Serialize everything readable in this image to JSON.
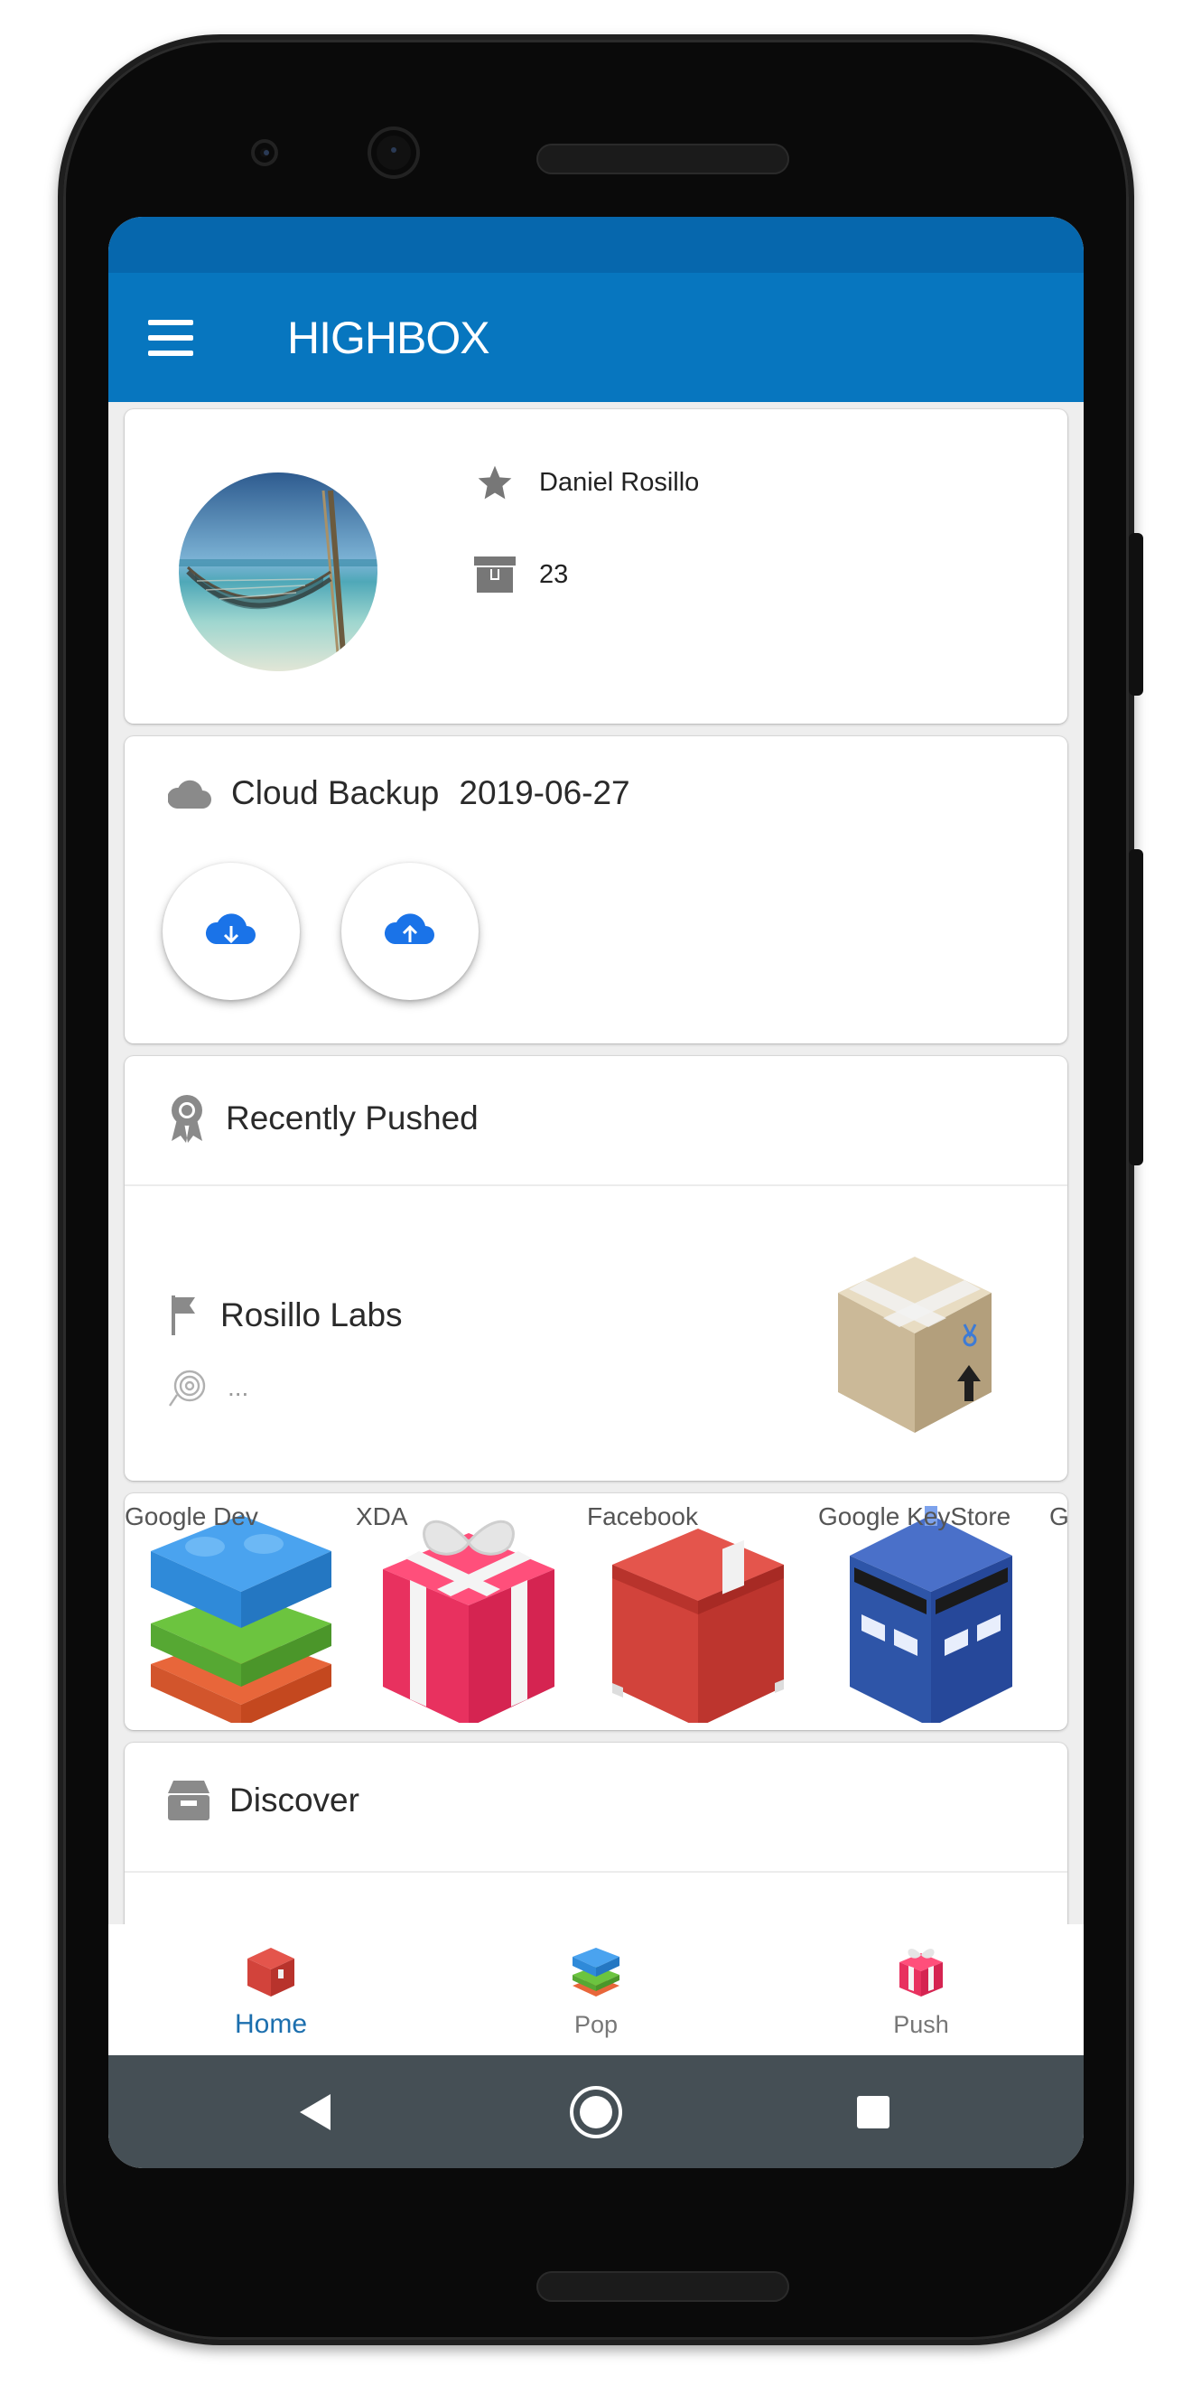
{
  "app": {
    "title": "HIGHBOX",
    "accent_color": "#0776bf",
    "status_bar_color": "#0667ad"
  },
  "profile": {
    "name": "Daniel Rosillo",
    "box_count": "23",
    "name_icon": "star-icon",
    "count_icon": "archive-box-icon"
  },
  "cloud_backup": {
    "title": "Cloud Backup",
    "date": "2019-06-27",
    "icon": "cloud-icon",
    "download_icon": "cloud-download-icon",
    "upload_icon": "cloud-upload-icon"
  },
  "recently_pushed": {
    "title": "Recently Pushed",
    "icon": "award-ribbon-icon",
    "item": {
      "name": "Rosillo Labs",
      "detail": "...",
      "name_icon": "flag-icon",
      "detail_icon": "fingerprint-icon"
    }
  },
  "carousel": {
    "items": [
      {
        "label": "Google Dev",
        "icon": "lego-brick-box-icon"
      },
      {
        "label": "XDA",
        "icon": "gift-box-icon"
      },
      {
        "label": "Facebook",
        "icon": "red-crate-icon"
      },
      {
        "label": "Google KeyStore",
        "icon": "police-box-icon"
      },
      {
        "label": "G",
        "icon": "box-icon"
      }
    ]
  },
  "discover": {
    "title": "Discover",
    "icon": "archive-drawer-icon"
  },
  "bottom_nav": {
    "active_color": "#1c6fae",
    "items": [
      {
        "label": "Home",
        "icon": "red-box-icon",
        "active": true
      },
      {
        "label": "Pop",
        "icon": "lego-stack-icon",
        "active": false
      },
      {
        "label": "Push",
        "icon": "gift-icon",
        "active": false
      }
    ]
  },
  "system_nav": {
    "back": "back-triangle-icon",
    "home": "home-circle-icon",
    "recents": "recents-square-icon"
  }
}
